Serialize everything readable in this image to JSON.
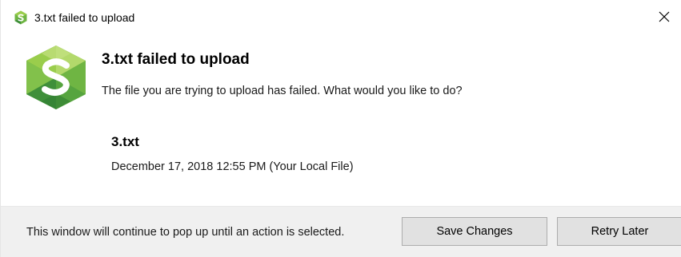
{
  "window": {
    "title": "3.txt failed to upload",
    "close_glyph": "✕"
  },
  "dialog": {
    "heading": "3.txt failed to upload",
    "message": "The file you are trying to upload has failed. What would you like to do?",
    "file": {
      "name": "3.txt",
      "details": "December 17, 2018 12:55 PM (Your Local File)"
    }
  },
  "footer": {
    "note": "This window will continue to pop up until an action is selected.",
    "save_label": "Save Changes",
    "retry_label": "Retry Later"
  },
  "icons": {
    "app": "app-logo-icon",
    "close": "close-icon"
  },
  "colors": {
    "logo_light": "#9acd4c",
    "logo_mid": "#6fb543",
    "logo_dark": "#3f8f3a",
    "footer_bg": "#f0f0f0",
    "button_bg": "#e1e1e1"
  }
}
